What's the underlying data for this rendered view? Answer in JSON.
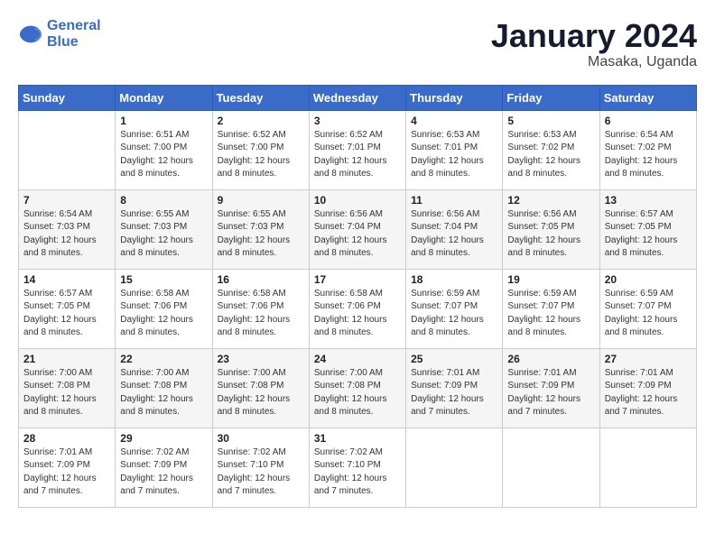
{
  "header": {
    "logo_line1": "General",
    "logo_line2": "Blue",
    "month": "January 2024",
    "location": "Masaka, Uganda"
  },
  "weekdays": [
    "Sunday",
    "Monday",
    "Tuesday",
    "Wednesday",
    "Thursday",
    "Friday",
    "Saturday"
  ],
  "weeks": [
    [
      {
        "day": "",
        "sunrise": "",
        "sunset": "",
        "daylight": ""
      },
      {
        "day": "1",
        "sunrise": "Sunrise: 6:51 AM",
        "sunset": "Sunset: 7:00 PM",
        "daylight": "Daylight: 12 hours and 8 minutes."
      },
      {
        "day": "2",
        "sunrise": "Sunrise: 6:52 AM",
        "sunset": "Sunset: 7:00 PM",
        "daylight": "Daylight: 12 hours and 8 minutes."
      },
      {
        "day": "3",
        "sunrise": "Sunrise: 6:52 AM",
        "sunset": "Sunset: 7:01 PM",
        "daylight": "Daylight: 12 hours and 8 minutes."
      },
      {
        "day": "4",
        "sunrise": "Sunrise: 6:53 AM",
        "sunset": "Sunset: 7:01 PM",
        "daylight": "Daylight: 12 hours and 8 minutes."
      },
      {
        "day": "5",
        "sunrise": "Sunrise: 6:53 AM",
        "sunset": "Sunset: 7:02 PM",
        "daylight": "Daylight: 12 hours and 8 minutes."
      },
      {
        "day": "6",
        "sunrise": "Sunrise: 6:54 AM",
        "sunset": "Sunset: 7:02 PM",
        "daylight": "Daylight: 12 hours and 8 minutes."
      }
    ],
    [
      {
        "day": "7",
        "sunrise": "Sunrise: 6:54 AM",
        "sunset": "Sunset: 7:03 PM",
        "daylight": "Daylight: 12 hours and 8 minutes."
      },
      {
        "day": "8",
        "sunrise": "Sunrise: 6:55 AM",
        "sunset": "Sunset: 7:03 PM",
        "daylight": "Daylight: 12 hours and 8 minutes."
      },
      {
        "day": "9",
        "sunrise": "Sunrise: 6:55 AM",
        "sunset": "Sunset: 7:03 PM",
        "daylight": "Daylight: 12 hours and 8 minutes."
      },
      {
        "day": "10",
        "sunrise": "Sunrise: 6:56 AM",
        "sunset": "Sunset: 7:04 PM",
        "daylight": "Daylight: 12 hours and 8 minutes."
      },
      {
        "day": "11",
        "sunrise": "Sunrise: 6:56 AM",
        "sunset": "Sunset: 7:04 PM",
        "daylight": "Daylight: 12 hours and 8 minutes."
      },
      {
        "day": "12",
        "sunrise": "Sunrise: 6:56 AM",
        "sunset": "Sunset: 7:05 PM",
        "daylight": "Daylight: 12 hours and 8 minutes."
      },
      {
        "day": "13",
        "sunrise": "Sunrise: 6:57 AM",
        "sunset": "Sunset: 7:05 PM",
        "daylight": "Daylight: 12 hours and 8 minutes."
      }
    ],
    [
      {
        "day": "14",
        "sunrise": "Sunrise: 6:57 AM",
        "sunset": "Sunset: 7:05 PM",
        "daylight": "Daylight: 12 hours and 8 minutes."
      },
      {
        "day": "15",
        "sunrise": "Sunrise: 6:58 AM",
        "sunset": "Sunset: 7:06 PM",
        "daylight": "Daylight: 12 hours and 8 minutes."
      },
      {
        "day": "16",
        "sunrise": "Sunrise: 6:58 AM",
        "sunset": "Sunset: 7:06 PM",
        "daylight": "Daylight: 12 hours and 8 minutes."
      },
      {
        "day": "17",
        "sunrise": "Sunrise: 6:58 AM",
        "sunset": "Sunset: 7:06 PM",
        "daylight": "Daylight: 12 hours and 8 minutes."
      },
      {
        "day": "18",
        "sunrise": "Sunrise: 6:59 AM",
        "sunset": "Sunset: 7:07 PM",
        "daylight": "Daylight: 12 hours and 8 minutes."
      },
      {
        "day": "19",
        "sunrise": "Sunrise: 6:59 AM",
        "sunset": "Sunset: 7:07 PM",
        "daylight": "Daylight: 12 hours and 8 minutes."
      },
      {
        "day": "20",
        "sunrise": "Sunrise: 6:59 AM",
        "sunset": "Sunset: 7:07 PM",
        "daylight": "Daylight: 12 hours and 8 minutes."
      }
    ],
    [
      {
        "day": "21",
        "sunrise": "Sunrise: 7:00 AM",
        "sunset": "Sunset: 7:08 PM",
        "daylight": "Daylight: 12 hours and 8 minutes."
      },
      {
        "day": "22",
        "sunrise": "Sunrise: 7:00 AM",
        "sunset": "Sunset: 7:08 PM",
        "daylight": "Daylight: 12 hours and 8 minutes."
      },
      {
        "day": "23",
        "sunrise": "Sunrise: 7:00 AM",
        "sunset": "Sunset: 7:08 PM",
        "daylight": "Daylight: 12 hours and 8 minutes."
      },
      {
        "day": "24",
        "sunrise": "Sunrise: 7:00 AM",
        "sunset": "Sunset: 7:08 PM",
        "daylight": "Daylight: 12 hours and 8 minutes."
      },
      {
        "day": "25",
        "sunrise": "Sunrise: 7:01 AM",
        "sunset": "Sunset: 7:09 PM",
        "daylight": "Daylight: 12 hours and 7 minutes."
      },
      {
        "day": "26",
        "sunrise": "Sunrise: 7:01 AM",
        "sunset": "Sunset: 7:09 PM",
        "daylight": "Daylight: 12 hours and 7 minutes."
      },
      {
        "day": "27",
        "sunrise": "Sunrise: 7:01 AM",
        "sunset": "Sunset: 7:09 PM",
        "daylight": "Daylight: 12 hours and 7 minutes."
      }
    ],
    [
      {
        "day": "28",
        "sunrise": "Sunrise: 7:01 AM",
        "sunset": "Sunset: 7:09 PM",
        "daylight": "Daylight: 12 hours and 7 minutes."
      },
      {
        "day": "29",
        "sunrise": "Sunrise: 7:02 AM",
        "sunset": "Sunset: 7:09 PM",
        "daylight": "Daylight: 12 hours and 7 minutes."
      },
      {
        "day": "30",
        "sunrise": "Sunrise: 7:02 AM",
        "sunset": "Sunset: 7:10 PM",
        "daylight": "Daylight: 12 hours and 7 minutes."
      },
      {
        "day": "31",
        "sunrise": "Sunrise: 7:02 AM",
        "sunset": "Sunset: 7:10 PM",
        "daylight": "Daylight: 12 hours and 7 minutes."
      },
      {
        "day": "",
        "sunrise": "",
        "sunset": "",
        "daylight": ""
      },
      {
        "day": "",
        "sunrise": "",
        "sunset": "",
        "daylight": ""
      },
      {
        "day": "",
        "sunrise": "",
        "sunset": "",
        "daylight": ""
      }
    ]
  ]
}
